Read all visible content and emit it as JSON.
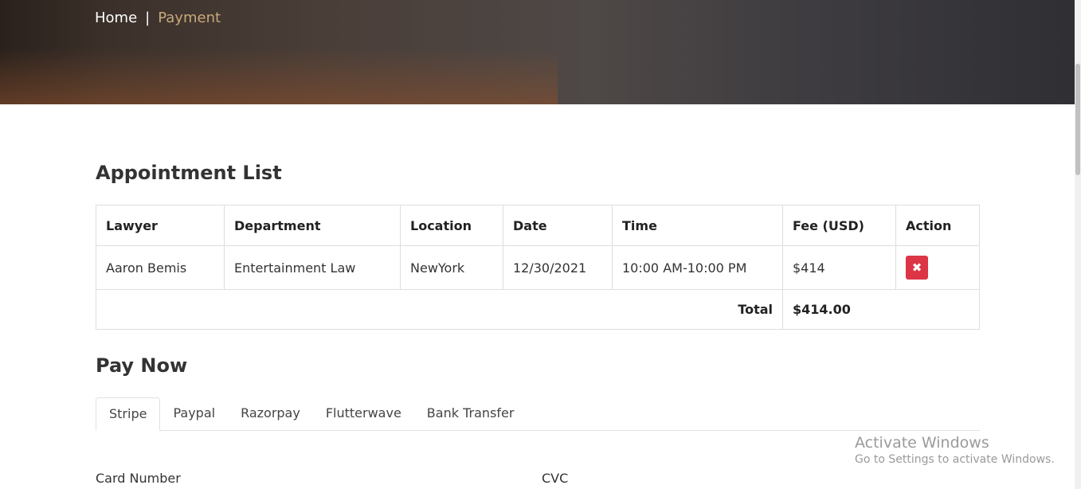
{
  "breadcrumb": {
    "home": "Home",
    "separator": "|",
    "current": "Payment"
  },
  "appointments": {
    "title": "Appointment List",
    "columns": [
      "Lawyer",
      "Department",
      "Location",
      "Date",
      "Time",
      "Fee (USD)",
      "Action"
    ],
    "rows": [
      {
        "lawyer": "Aaron Bemis",
        "department": "Entertainment Law",
        "location": "NewYork",
        "date": "12/30/2021",
        "time": "10:00 AM-10:00 PM",
        "fee": "$414",
        "action_icon": "close-icon"
      }
    ],
    "total_label": "Total",
    "total_value": "$414.00"
  },
  "payment": {
    "title": "Pay Now",
    "tabs": [
      "Stripe",
      "Paypal",
      "Razorpay",
      "Flutterwave",
      "Bank Transfer"
    ],
    "active_tab": "Stripe",
    "card_number_label": "Card Number",
    "cvc_label": "CVC"
  },
  "watermark": {
    "line1": "Activate Windows",
    "line2": "Go to Settings to activate Windows."
  },
  "colors": {
    "accent": "#c7a97a",
    "danger": "#dc3545"
  }
}
